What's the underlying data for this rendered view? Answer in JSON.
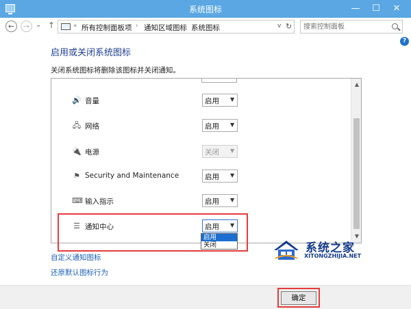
{
  "window": {
    "title": "系统图标",
    "min": "—",
    "max": "☐",
    "close": "✕"
  },
  "nav": {
    "back": "←",
    "forward": "→",
    "up": "↑",
    "chevrons": "«",
    "breadcrumbs": [
      "所有控制面板项",
      "通知区域图标",
      "系统图标"
    ],
    "separator": "›",
    "dropdown": "v",
    "refresh": "↻",
    "search_placeholder": "搜索控制面板"
  },
  "help": "?",
  "heading": "启用或关闭系统图标",
  "description": "关闭系统图标将删除该图标并关闭通知。",
  "rows": [
    {
      "icon": "speaker-icon",
      "glyph": "🔊",
      "label": "音量",
      "value": "启用",
      "disabled": false
    },
    {
      "icon": "network-icon",
      "glyph": "🖧",
      "label": "网络",
      "value": "启用",
      "disabled": false
    },
    {
      "icon": "power-icon",
      "glyph": "🔌",
      "label": "电源",
      "value": "关闭",
      "disabled": true
    },
    {
      "icon": "flag-icon",
      "glyph": "⚑",
      "label": "Security and Maintenance",
      "value": "启用",
      "disabled": false
    },
    {
      "icon": "keyboard-icon",
      "glyph": "⌨",
      "label": "输入指示",
      "value": "启用",
      "disabled": false
    },
    {
      "icon": "action-center-icon",
      "glyph": "☰",
      "label": "通知中心",
      "value": "启用",
      "disabled": false
    }
  ],
  "dropdown_options": [
    "启用",
    "关闭"
  ],
  "scroll": {
    "up": "▲",
    "down": "▼"
  },
  "links": {
    "customize": "自定义通知图标",
    "restore": "还原默认图标行为"
  },
  "ok_button": "确定",
  "watermark": {
    "name": "系统之家",
    "url": "XITONGZHIJIA.NET"
  },
  "colors": {
    "titlebar": "#5aa7e3",
    "heading": "#1e3e92",
    "link": "#1c5fb5",
    "highlight": "#e23b3b",
    "selected_option": "#1c6fd1"
  }
}
